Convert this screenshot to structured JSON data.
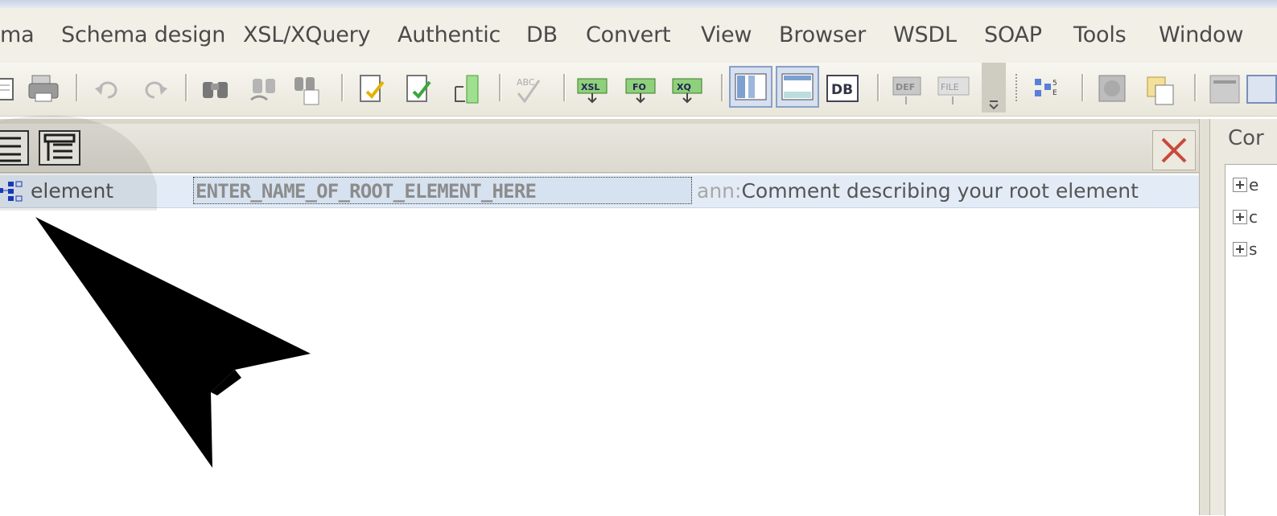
{
  "menu": {
    "items": [
      {
        "label": "ma"
      },
      {
        "label": "Schema design"
      },
      {
        "label": "XSL/XQuery"
      },
      {
        "label": "Authentic"
      },
      {
        "label": "DB"
      },
      {
        "label": "Convert"
      },
      {
        "label": "View"
      },
      {
        "label": "Browser"
      },
      {
        "label": "WSDL"
      },
      {
        "label": "SOAP"
      },
      {
        "label": "Tools"
      },
      {
        "label": "Window"
      }
    ]
  },
  "toolbar": {
    "icons": [
      "new-document-icon",
      "print-icon",
      "undo-icon",
      "redo-icon",
      "find-icon",
      "find-next-icon",
      "replace-icon",
      "check-wellformed-icon",
      "validate-icon",
      "insert-icon",
      "spellcheck-icon",
      "xsl-transform-icon",
      "fo-transform-icon",
      "xquery-icon",
      "grid-view-icon",
      "text-view-icon",
      "db-view-icon",
      "def-icon",
      "file-icon",
      "overflow-icon",
      "schema-icon",
      "image-icon",
      "copy-icon",
      "window-icon"
    ]
  },
  "schema": {
    "row": {
      "type": "element",
      "name": "ENTER_NAME_OF_ROOT_ELEMENT_HERE",
      "ann_prefix": "ann:",
      "ann_text": "Comment describing your root element"
    }
  },
  "right_panel": {
    "title": "Cor",
    "tree": [
      {
        "label": "e"
      },
      {
        "label": "c"
      },
      {
        "label": "s"
      }
    ]
  },
  "colors": {
    "menubar": "#f1efe6",
    "row_highlight": "#e3ecf6",
    "close_red": "#c84a3a"
  }
}
